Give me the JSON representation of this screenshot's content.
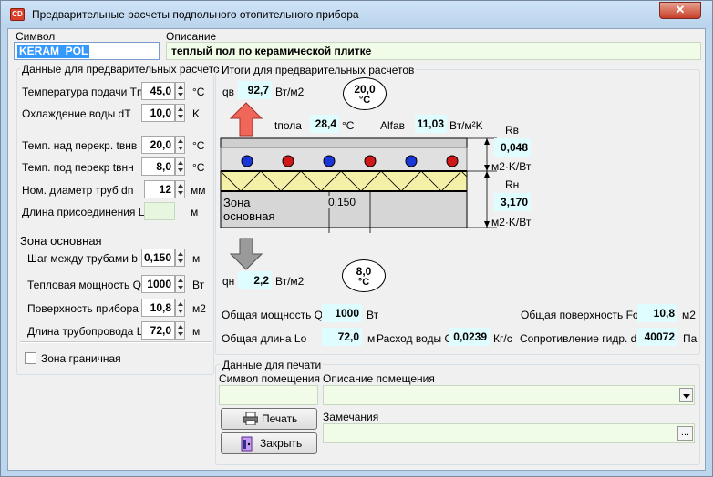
{
  "window": {
    "title": "Предварительные расчеты подпольного отопительного прибора",
    "close": "✕"
  },
  "header": {
    "symbol_label": "Символ",
    "symbol_value": "KERAM_POL",
    "description_label": "Описание",
    "description_value": "теплый пол по керамической плитке"
  },
  "input_group": {
    "title": "Данные для предварительных расчетов",
    "rows": [
      {
        "label": "Температура подачи  Tn",
        "value": "45,0",
        "unit": "°C"
      },
      {
        "label": "Охлаждение воды dT",
        "value": "10,0",
        "unit": "K"
      },
      {
        "label": "Темп. над перекр. tвнв",
        "value": "20,0",
        "unit": "°C"
      },
      {
        "label": "Темп. под перекр tвнн",
        "value": "8,0",
        "unit": "°C"
      },
      {
        "label": "Ном. диаметр труб dn",
        "value": "12",
        "unit": "мм"
      },
      {
        "label": "Длина присоединения Ln",
        "value": "",
        "unit": "м"
      }
    ],
    "zone_title": "Зона основная",
    "zone_rows": [
      {
        "label": "Шаг между трубами b",
        "value": "0,150",
        "unit": "м"
      },
      {
        "label": "Тепловая мощность Qo",
        "value": "1000",
        "unit": "Вт"
      },
      {
        "label": "Поверхность прибора F",
        "value": "10,8",
        "unit": "м2"
      },
      {
        "label": "Длина трубопровода L",
        "value": "72,0",
        "unit": "м"
      }
    ],
    "boundary_checkbox": "Зона граничная"
  },
  "results": {
    "title": "Итоги для предварительных расчетов",
    "qv_label": "qв",
    "qv_value": "92,7",
    "qv_unit": "Вт/м2",
    "top_temp": "20,0",
    "top_temp_unit": "°C",
    "tpola_label": "tпола",
    "tpola_value": "28,4",
    "tpola_unit": "°C",
    "alfa_label": "Alfaв",
    "alfa_value": "11,03",
    "alfa_unit": "Вт/м²K",
    "rv_label": "Rв",
    "rv_value": "0,048",
    "rv_unit": "м2·K/Вт",
    "rn_label": "Rн",
    "rn_value": "3,170",
    "rn_unit": "м2·K/Вт",
    "zone_text_1": "Зона",
    "zone_text_2": "основная",
    "spacing": "0,150",
    "qn_label": "qн",
    "qn_value": "2,2",
    "qn_unit": "Вт/м2",
    "bottom_temp": "8,0",
    "bottom_temp_unit": "°C",
    "total_power_label": "Общая мощность Qo",
    "total_power_value": "1000",
    "total_power_unit": "Вт",
    "total_surface_label": "Общая поверхность Fo",
    "total_surface_value": "10,8",
    "total_surface_unit": "м2",
    "total_length_label": "Общая длина Lo",
    "total_length_value": "72,0",
    "total_length_unit": "м",
    "flow_label": "Расход воды G",
    "flow_value": "0,0239",
    "flow_unit": "Кг/с",
    "resistance_label": "Сопротивление гидр. dP",
    "resistance_value": "40072",
    "resistance_unit": "Па"
  },
  "print_group": {
    "title": "Данные для печати",
    "room_symbol_label": "Символ помещения",
    "room_desc_label": "Описание помещения",
    "remarks_label": "Замечания",
    "print_button": "Печать",
    "close_button": "Закрыть",
    "ellipsis": "..."
  },
  "colors": {
    "pipe_blue": "#1b36d6",
    "pipe_red": "#d01818",
    "arrow_up": "#f0675a",
    "arrow_down": "#9a9a9a",
    "result_bg": "#dffdff"
  }
}
